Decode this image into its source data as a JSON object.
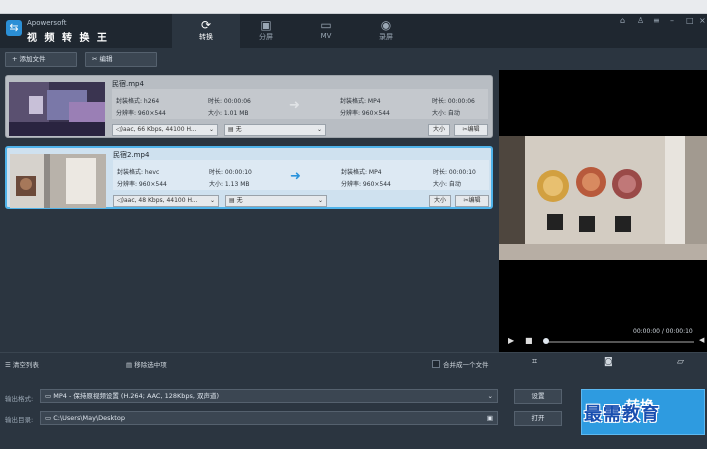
{
  "app": {
    "brand_small": "Apowersoft",
    "brand_big": "视 频 转 换 王"
  },
  "tabs": [
    {
      "label": "转换",
      "icon": "refresh-icon",
      "active": true
    },
    {
      "label": "分屏",
      "icon": "split-screen-icon",
      "active": false
    },
    {
      "label": "MV",
      "icon": "tv-icon",
      "active": false
    },
    {
      "label": "录屏",
      "icon": "record-icon",
      "active": false
    }
  ],
  "toolbar": {
    "add_file": "添加文件",
    "edit": "编辑"
  },
  "files": [
    {
      "name": "民宿.mp4",
      "src_format": "封装格式: h264",
      "src_duration": "时长: 00:00:06",
      "src_resolution": "分辨率: 960×544",
      "src_size": "大小: 1.01 MB",
      "dst_format": "封装格式: MP4",
      "dst_duration": "时长: 00:00:06",
      "dst_resolution": "分辨率: 960×544",
      "dst_size": "大小: 自动",
      "audio": "aac, 66 Kbps, 44100 H...",
      "subtitle": "无",
      "size_btn": "大小",
      "edit_btn": "编辑"
    },
    {
      "name": "民宿2.mp4",
      "src_format": "封装格式: hevc",
      "src_duration": "时长: 00:00:10",
      "src_resolution": "分辨率: 960×544",
      "src_size": "大小: 1.13 MB",
      "dst_format": "封装格式: MP4",
      "dst_duration": "时长: 00:00:10",
      "dst_resolution": "分辨率: 960×544",
      "dst_size": "大小: 自动",
      "audio": "aac, 48 Kbps, 44100 H...",
      "subtitle": "无",
      "size_btn": "大小",
      "edit_btn": "编辑"
    }
  ],
  "player": {
    "time": "00:00:00 / 00:00:10",
    "progress": 0.0
  },
  "list_actions": {
    "clear": "清空列表",
    "remove": "移除选中项",
    "merge": "合并成一个文件"
  },
  "output": {
    "format_label": "输出格式:",
    "format_value": "MP4 - 保持原视频设置 (H.264; AAC, 128Kbps, 双声道)",
    "dir_label": "输出目录:",
    "dir_value": "C:\\Users\\May\\Desktop",
    "settings_btn": "设置",
    "open_btn": "打开"
  },
  "convert_btn": "转换",
  "watermark": "最需教育",
  "colors": {
    "accent": "#2e9be0",
    "selected_border": "#4fb3ea",
    "arrow_active": "#2a93dc"
  }
}
